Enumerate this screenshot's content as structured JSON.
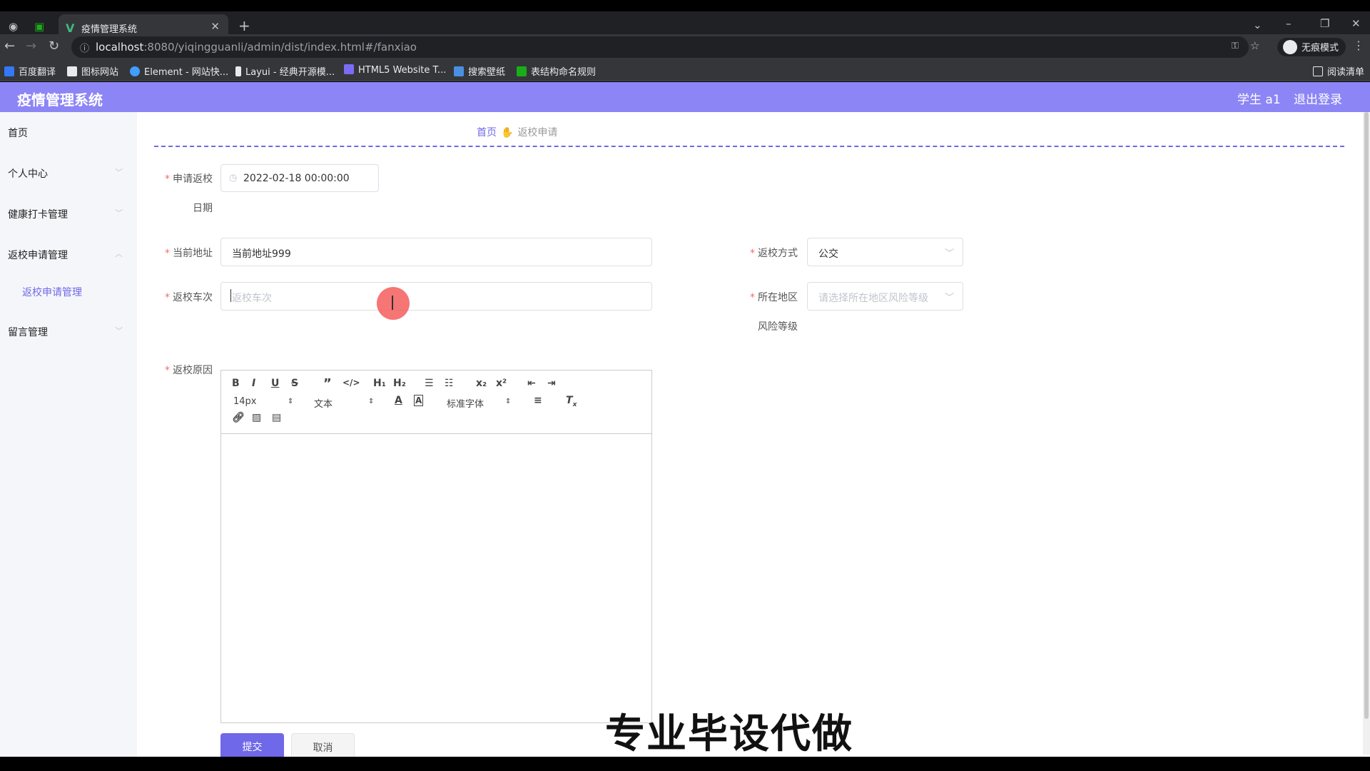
{
  "browser": {
    "tab_title": "疫情管理系统",
    "url_host": "localhost",
    "url_rest": ":8080/yiqingguanli/admin/dist/index.html#/fanxiao",
    "incognito_label": "无痕模式",
    "reading_list": "阅读清单",
    "bookmarks": [
      "百度翻译",
      "图标网站",
      "Element - 网站快...",
      "Layui - 经典开源模...",
      "HTML5 Website T...",
      "搜索壁纸",
      "表结构命名规则"
    ]
  },
  "header": {
    "brand": "疫情管理系统",
    "user": "学生 a1",
    "logout": "退出登录"
  },
  "sidebar": {
    "items": [
      {
        "label": "首页"
      },
      {
        "label": "个人中心"
      },
      {
        "label": "健康打卡管理"
      },
      {
        "label": "返校申请管理"
      },
      {
        "label": "留言管理"
      }
    ],
    "sub_item": "返校申请管理"
  },
  "breadcrumb": {
    "home": "首页",
    "current": "返校申请"
  },
  "form": {
    "apply_date_label_1": "申请返校",
    "apply_date_label_2": "日期",
    "apply_date_value": "2022-02-18 00:00:00",
    "address_label": "当前地址",
    "address_value": "当前地址999",
    "method_label": "返校方式",
    "method_value": "公交",
    "train_label": "返校车次",
    "train_placeholder": "返校车次",
    "region_label_1": "所在地区",
    "region_label_2": "风险等级",
    "region_placeholder": "请选择所在地区风险等级",
    "reason_label": "返校原因"
  },
  "editor": {
    "font_size": "14px",
    "header_select": "文本",
    "font_family": "标准字体"
  },
  "buttons": {
    "submit": "提交",
    "cancel": "取消"
  },
  "watermark": "专业毕设代做",
  "colors": {
    "accent": "#6f68e8",
    "header": "#8c85f5",
    "required": "#f56c6c"
  }
}
